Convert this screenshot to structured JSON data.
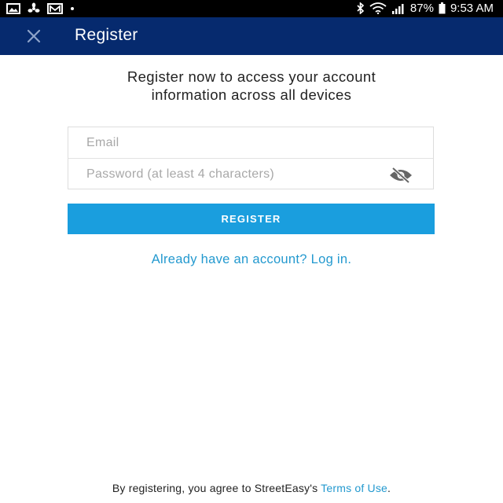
{
  "status_bar": {
    "left_icons": [
      "image-icon",
      "fan-icon",
      "mail-icon",
      "dot-icon"
    ],
    "right_icons": [
      "bluetooth-icon",
      "wifi-icon",
      "signal-icon",
      "battery-icon"
    ],
    "battery": "87%",
    "time": "9:53 AM"
  },
  "app_bar": {
    "title": "Register",
    "close_icon": "close-icon",
    "background": "#062a6e"
  },
  "intro": {
    "line1": "Register now to access your account",
    "line2": "information across all devices"
  },
  "form": {
    "email_placeholder": "Email",
    "password_placeholder": "Password (at least 4 characters)",
    "visibility_icon": "eye-off-icon"
  },
  "register_button": {
    "label": "REGISTER",
    "color": "#1a9ede"
  },
  "login_link": "Already have an account? Log in.",
  "footer": {
    "prefix": "By registering, you agree to StreetEasy's ",
    "link": "Terms of Use",
    "suffix": "."
  }
}
